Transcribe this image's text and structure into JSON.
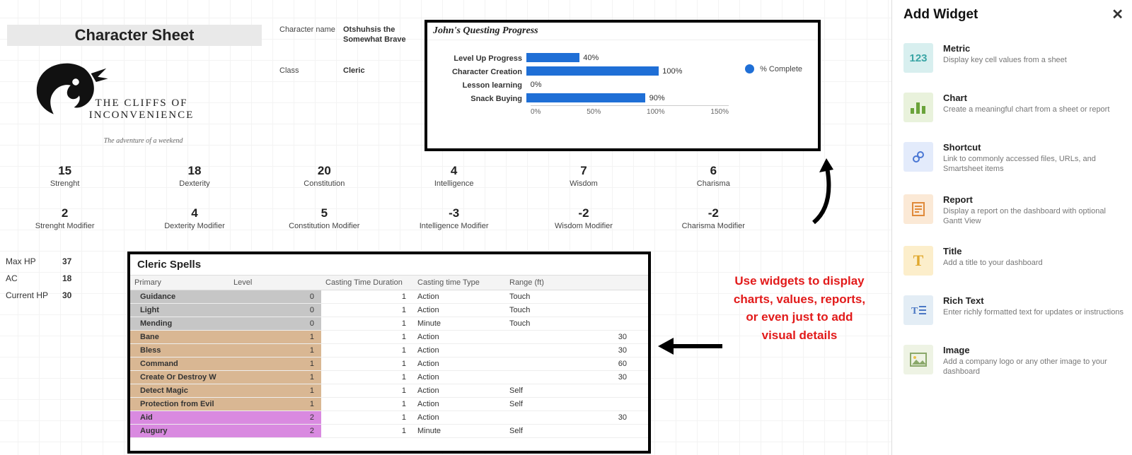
{
  "title": "Character Sheet",
  "logo": {
    "title": "THE CLIFFS OF INCONVENIENCE",
    "subtitle": "The adventure of a weekend"
  },
  "character": {
    "name_label": "Character name",
    "name": "Otshuhsis the Somewhat Brave",
    "class_label": "Class",
    "class": "Cleric"
  },
  "chart_data": {
    "type": "bar",
    "title": "John's Questing Progress",
    "categories": [
      "Level Up Progress",
      "Character Creation",
      "Lesson learning",
      "Snack Buying"
    ],
    "values": [
      40,
      100,
      0,
      90
    ],
    "xlabels": [
      "0%",
      "50%",
      "100%",
      "150%"
    ],
    "xlim": [
      0,
      150
    ],
    "legend": "% Complete"
  },
  "stats": [
    {
      "value": "15",
      "label": "Strenght"
    },
    {
      "value": "18",
      "label": "Dexterity"
    },
    {
      "value": "20",
      "label": "Constitution"
    },
    {
      "value": "4",
      "label": "Intelligence"
    },
    {
      "value": "7",
      "label": "Wisdom"
    },
    {
      "value": "6",
      "label": "Charisma"
    }
  ],
  "modifiers": [
    {
      "value": "2",
      "label": "Strenght Modifier"
    },
    {
      "value": "4",
      "label": "Dexterity Modifier"
    },
    {
      "value": "5",
      "label": "Constitution Modifier"
    },
    {
      "value": "-3",
      "label": "Intelligence Modifier"
    },
    {
      "value": "-2",
      "label": "Wisdom Modifier"
    },
    {
      "value": "-2",
      "label": "Charisma Modifier"
    }
  ],
  "hp": {
    "max_label": "Max HP",
    "max": "37",
    "ac_label": "AC",
    "ac": "18",
    "cur_label": "Current HP",
    "cur": "30"
  },
  "spells": {
    "title": "Cleric Spells",
    "columns": [
      "Primary",
      "Level",
      "Casting Time Duration",
      "Casting time Type",
      "Range (ft)"
    ],
    "rows": [
      {
        "primary": "Guidance",
        "level": "0",
        "duration": "1",
        "type": "Action",
        "range": "Touch",
        "lv": 0
      },
      {
        "primary": "Light",
        "level": "0",
        "duration": "1",
        "type": "Action",
        "range": "Touch",
        "lv": 0
      },
      {
        "primary": "Mending",
        "level": "0",
        "duration": "1",
        "type": "Minute",
        "range": "Touch",
        "lv": 0
      },
      {
        "primary": "Bane",
        "level": "1",
        "duration": "1",
        "type": "Action",
        "range": "30",
        "lv": 1
      },
      {
        "primary": "Bless",
        "level": "1",
        "duration": "1",
        "type": "Action",
        "range": "30",
        "lv": 1
      },
      {
        "primary": "Command",
        "level": "1",
        "duration": "1",
        "type": "Action",
        "range": "60",
        "lv": 1
      },
      {
        "primary": "Create Or Destroy W",
        "level": "1",
        "duration": "1",
        "type": "Action",
        "range": "30",
        "lv": 1
      },
      {
        "primary": "Detect Magic",
        "level": "1",
        "duration": "1",
        "type": "Action",
        "range": "Self",
        "lv": 1
      },
      {
        "primary": "Protection from Evil",
        "level": "1",
        "duration": "1",
        "type": "Action",
        "range": "Self",
        "lv": 1
      },
      {
        "primary": "Aid",
        "level": "2",
        "duration": "1",
        "type": "Action",
        "range": "30",
        "lv": 2
      },
      {
        "primary": "Augury",
        "level": "2",
        "duration": "1",
        "type": "Minute",
        "range": "Self",
        "lv": 2
      }
    ]
  },
  "annotation": "Use widgets to display charts, values, reports, or even just to add visual details",
  "sidebar": {
    "title": "Add Widget",
    "items": [
      {
        "icon": "metric",
        "title": "Metric",
        "desc": "Display key cell values from a sheet"
      },
      {
        "icon": "chart",
        "title": "Chart",
        "desc": "Create a meaningful chart from a sheet or report"
      },
      {
        "icon": "shortcut",
        "title": "Shortcut",
        "desc": "Link to commonly accessed files, URLs, and Smartsheet items"
      },
      {
        "icon": "report",
        "title": "Report",
        "desc": "Display a report on the dashboard with optional Gantt View"
      },
      {
        "icon": "title",
        "title": "Title",
        "desc": "Add a title to your dashboard"
      },
      {
        "icon": "richtext",
        "title": "Rich Text",
        "desc": "Enter richly formatted text for updates or instructions"
      },
      {
        "icon": "image",
        "title": "Image",
        "desc": "Add a company logo or any other image to your dashboard"
      }
    ]
  }
}
